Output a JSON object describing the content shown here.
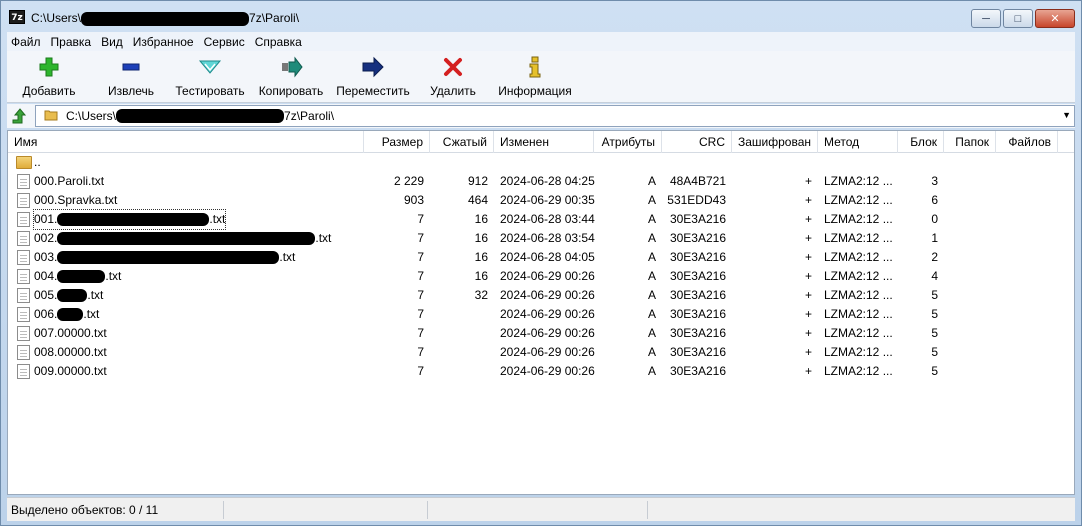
{
  "window": {
    "app_icon": "7z",
    "title_prefix": "C:\\Users\\",
    "title_suffix": "7z\\Paroli\\",
    "buttons": {
      "minimize": "minimize-icon",
      "maximize": "maximize-icon",
      "close": "close-icon"
    }
  },
  "menu": {
    "items": [
      {
        "label": "Файл"
      },
      {
        "label": "Правка"
      },
      {
        "label": "Вид"
      },
      {
        "label": "Избранное"
      },
      {
        "label": "Сервис"
      },
      {
        "label": "Справка"
      }
    ]
  },
  "toolbar": {
    "add": {
      "label": "Добавить",
      "icon": "plus-icon",
      "color": "#2db52d"
    },
    "extract": {
      "label": "Извлечь",
      "icon": "minus-icon",
      "color": "#1c3fb8"
    },
    "test": {
      "label": "Тестировать",
      "icon": "check-down-icon",
      "color": "#2ab7b7"
    },
    "copy": {
      "label": "Копировать",
      "icon": "copy-arrow-icon",
      "color": "#1f8b7a"
    },
    "move": {
      "label": "Переместить",
      "icon": "arrow-right-icon",
      "color": "#16307f"
    },
    "delete": {
      "label": "Удалить",
      "icon": "red-x-icon",
      "color": "#d42020"
    },
    "info": {
      "label": "Информация",
      "icon": "info-icon",
      "color": "#e6c12a"
    }
  },
  "address": {
    "prefix": "C:\\Users\\",
    "suffix": "7z\\Paroli\\"
  },
  "columns": {
    "name": "Имя",
    "size": "Размер",
    "packed": "Сжатый",
    "modified": "Изменен",
    "attributes": "Атрибуты",
    "crc": "CRC",
    "encrypted": "Зашифрован",
    "method": "Метод",
    "block": "Блок",
    "folders": "Папок",
    "files": "Файлов"
  },
  "parent_row": {
    "name": ".."
  },
  "rows": [
    {
      "name_a": "000.Paroli.txt",
      "name_b": "",
      "size": "2 229",
      "packed": "912",
      "modified": "2024-06-28 04:25",
      "attr": "A",
      "crc": "48A4B721",
      "enc": "+",
      "method": "LZMA2:12 ...",
      "block": "3"
    },
    {
      "name_a": "000.Spravka.txt",
      "name_b": "",
      "size": "903",
      "packed": "464",
      "modified": "2024-06-29 00:35",
      "attr": "A",
      "crc": "531EDD43",
      "enc": "+",
      "method": "LZMA2:12 ...",
      "block": "6"
    },
    {
      "name_a": "001.",
      "name_b": ".txt",
      "size": "7",
      "packed": "16",
      "modified": "2024-06-28 03:44",
      "attr": "A",
      "crc": "30E3A216",
      "enc": "+",
      "method": "LZMA2:12 ...",
      "block": "0"
    },
    {
      "name_a": "002.",
      "name_b": ".txt",
      "size": "7",
      "packed": "16",
      "modified": "2024-06-28 03:54",
      "attr": "A",
      "crc": "30E3A216",
      "enc": "+",
      "method": "LZMA2:12 ...",
      "block": "1"
    },
    {
      "name_a": "003.",
      "name_b": ".txt",
      "size": "7",
      "packed": "16",
      "modified": "2024-06-28 04:05",
      "attr": "A",
      "crc": "30E3A216",
      "enc": "+",
      "method": "LZMA2:12 ...",
      "block": "2"
    },
    {
      "name_a": "004.",
      "name_b": ".txt",
      "size": "7",
      "packed": "16",
      "modified": "2024-06-29 00:26",
      "attr": "A",
      "crc": "30E3A216",
      "enc": "+",
      "method": "LZMA2:12 ...",
      "block": "4"
    },
    {
      "name_a": "005.",
      "name_b": ".txt",
      "size": "7",
      "packed": "32",
      "modified": "2024-06-29 00:26",
      "attr": "A",
      "crc": "30E3A216",
      "enc": "+",
      "method": "LZMA2:12 ...",
      "block": "5"
    },
    {
      "name_a": "006.",
      "name_b": ".txt",
      "size": "7",
      "packed": "",
      "modified": "2024-06-29 00:26",
      "attr": "A",
      "crc": "30E3A216",
      "enc": "+",
      "method": "LZMA2:12 ...",
      "block": "5"
    },
    {
      "name_a": "007.00000.txt",
      "name_b": "",
      "size": "7",
      "packed": "",
      "modified": "2024-06-29 00:26",
      "attr": "A",
      "crc": "30E3A216",
      "enc": "+",
      "method": "LZMA2:12 ...",
      "block": "5"
    },
    {
      "name_a": "008.00000.txt",
      "name_b": "",
      "size": "7",
      "packed": "",
      "modified": "2024-06-29 00:26",
      "attr": "A",
      "crc": "30E3A216",
      "enc": "+",
      "method": "LZMA2:12 ...",
      "block": "5"
    },
    {
      "name_a": "009.00000.txt",
      "name_b": "",
      "size": "7",
      "packed": "",
      "modified": "2024-06-29 00:26",
      "attr": "A",
      "crc": "30E3A216",
      "enc": "+",
      "method": "LZMA2:12 ...",
      "block": "5"
    }
  ],
  "status": {
    "selected": "Выделено объектов: 0 / 11"
  }
}
